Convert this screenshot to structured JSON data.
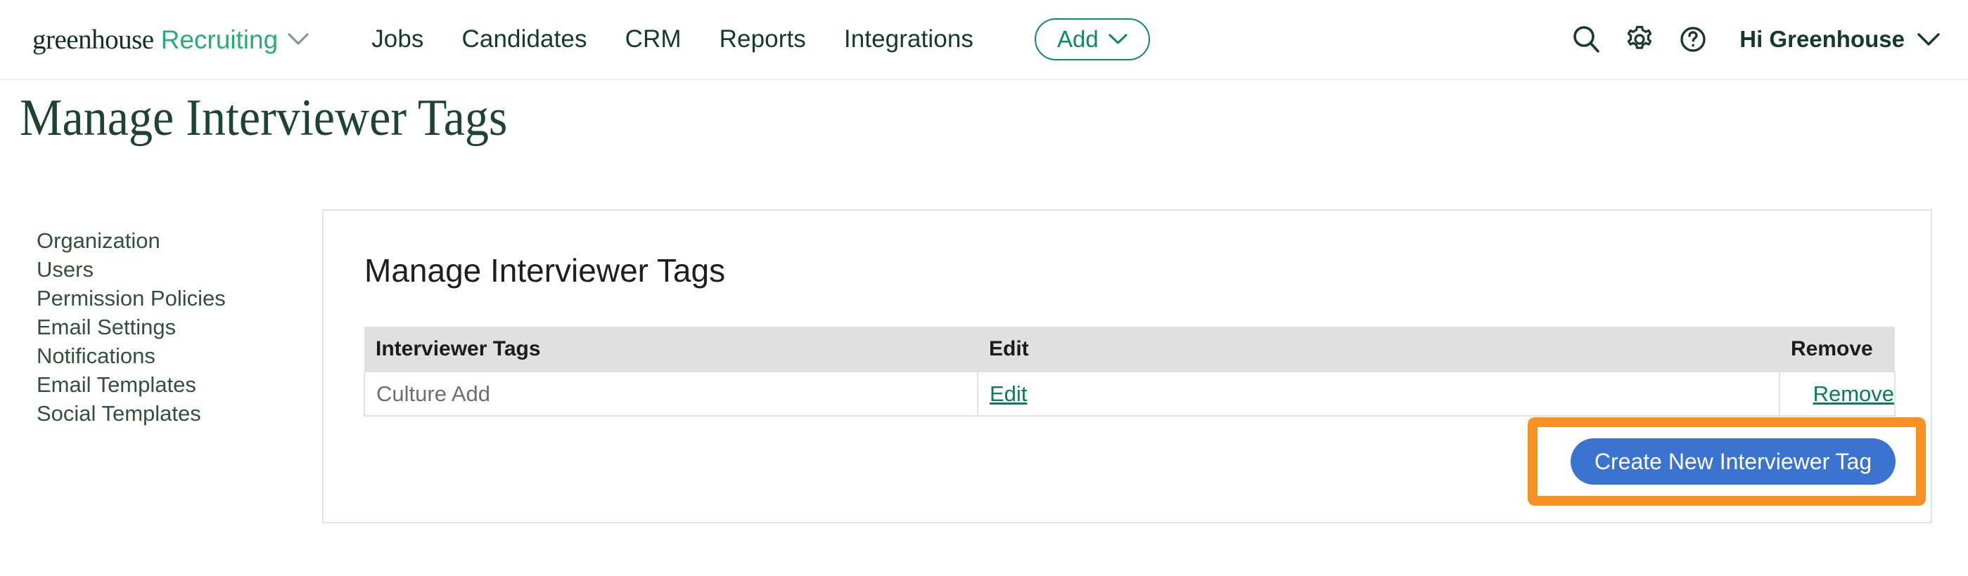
{
  "header": {
    "brand": {
      "name": "greenhouse",
      "product": "Recruiting",
      "caret_icon": "chevron-down-icon"
    },
    "nav_items": [
      {
        "label": "Jobs"
      },
      {
        "label": "Candidates"
      },
      {
        "label": "CRM"
      },
      {
        "label": "Reports"
      },
      {
        "label": "Integrations"
      }
    ],
    "add_button": {
      "label": "Add",
      "caret_icon": "chevron-down-icon"
    },
    "icons": [
      {
        "name": "search-icon"
      },
      {
        "name": "gear-icon"
      },
      {
        "name": "help-circle-icon"
      }
    ],
    "user_menu": {
      "label": "Hi Greenhouse",
      "caret_icon": "chevron-down-icon"
    }
  },
  "page": {
    "title": "Manage Interviewer Tags"
  },
  "sidebar": {
    "items": [
      {
        "label": "Organization"
      },
      {
        "label": "Users"
      },
      {
        "label": "Permission Policies"
      },
      {
        "label": "Email Settings"
      },
      {
        "label": "Notifications"
      },
      {
        "label": "Email Templates"
      },
      {
        "label": "Social Templates"
      }
    ]
  },
  "card": {
    "title": "Manage Interviewer Tags",
    "table": {
      "columns": [
        {
          "label": "Interviewer Tags"
        },
        {
          "label": "Edit"
        },
        {
          "label": "Remove"
        }
      ],
      "rows": [
        {
          "tag": "Culture Add",
          "edit": "Edit",
          "remove": "Remove"
        }
      ]
    },
    "create_button": {
      "label": "Create New Interviewer Tag"
    }
  },
  "colors": {
    "brand_dark_green": "#143b2a",
    "brand_accent_green": "#27ae75",
    "link_green": "#0a7d54",
    "primary_blue": "#3b73d1",
    "highlight_orange": "#fa9223",
    "table_header_grey": "#e0e0e0",
    "border_grey": "#e3e3e3"
  }
}
